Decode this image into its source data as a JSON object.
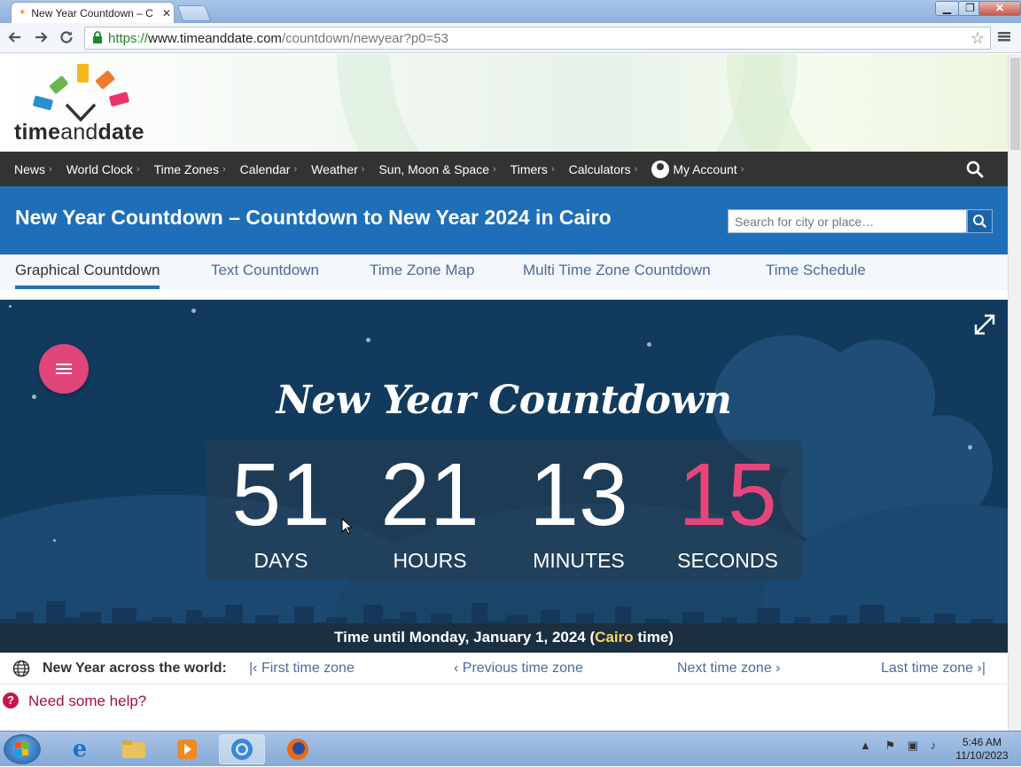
{
  "browser": {
    "tab_title": "New Year Countdown – C",
    "tab_close": "✕",
    "url_scheme": "https://",
    "url_host": "www.timeanddate.com",
    "url_path": "/countdown/newyear?p0=53",
    "win_min": "▁",
    "win_max": "❐",
    "win_close": "✕"
  },
  "logo": {
    "part1": "time",
    "part2": "and",
    "part3": "date"
  },
  "nav": {
    "items": [
      {
        "label": "News"
      },
      {
        "label": "World Clock"
      },
      {
        "label": "Time Zones"
      },
      {
        "label": "Calendar"
      },
      {
        "label": "Weather"
      },
      {
        "label": "Sun, Moon & Space"
      },
      {
        "label": "Timers"
      },
      {
        "label": "Calculators"
      }
    ],
    "account": "My Account",
    "chevron": "›"
  },
  "header": {
    "title": "New Year Countdown – Countdown to New Year 2024 in Cairo",
    "search_placeholder": "Search for city or place…"
  },
  "subtabs": [
    {
      "label": "Graphical Countdown"
    },
    {
      "label": "Text Countdown"
    },
    {
      "label": "Time Zone Map"
    },
    {
      "label": "Multi Time Zone Countdown"
    },
    {
      "label": "Time Schedule"
    }
  ],
  "countdown": {
    "heading": "New Year Countdown",
    "days": "51",
    "hours": "21",
    "minutes": "13",
    "seconds": "15",
    "days_label": "DAYS",
    "hours_label": "HOURS",
    "minutes_label": "MINUTES",
    "seconds_label": "SECONDS",
    "until_prefix": "Time until Monday, January 1, 2024 (",
    "until_city": "Cairo",
    "until_suffix": " time)",
    "accent_color": "#e6457c"
  },
  "world": {
    "label": "New Year across the world:",
    "first": "First time zone",
    "previous": "Previous time zone",
    "next": "Next time zone",
    "last": "Last time zone"
  },
  "help": {
    "icon": "?",
    "text": "Need some help?"
  },
  "taskbar": {
    "time": "5:46 AM",
    "date": "11/10/2023"
  }
}
